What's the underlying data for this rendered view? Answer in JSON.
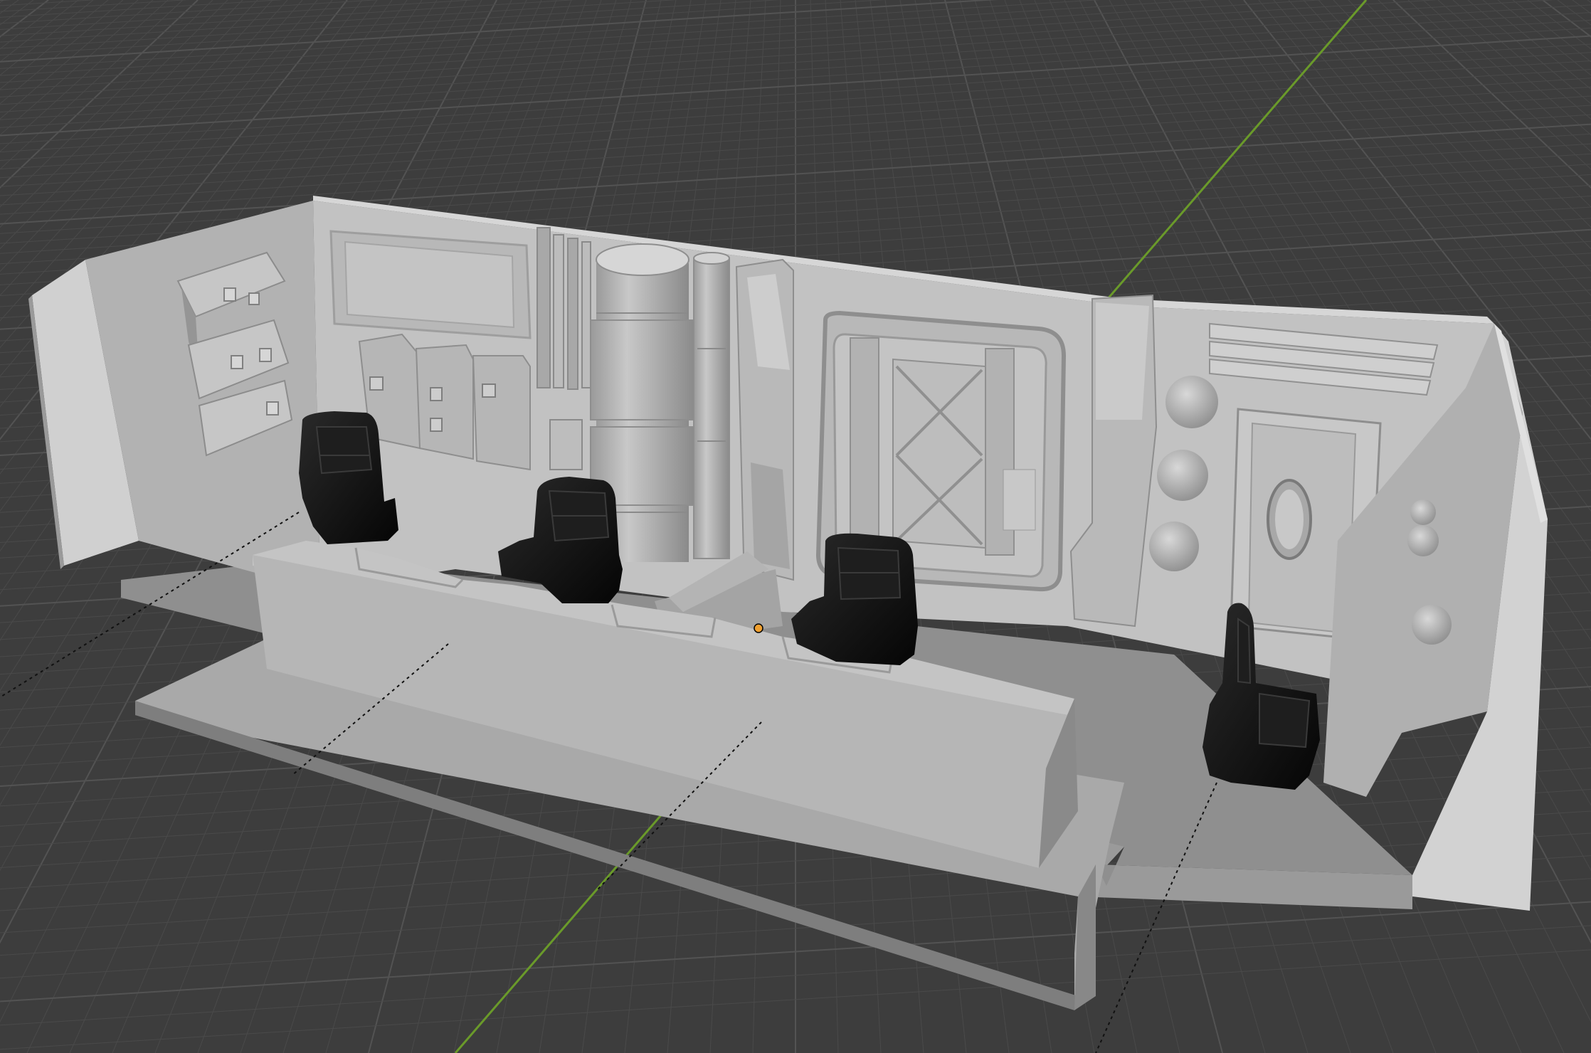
{
  "app": "3D viewport",
  "viewport": {
    "background_color": "#3d3d3d",
    "grid_line_color": "#4a4a4a",
    "grid_line_strong_color": "#535353",
    "y_axis_color": "#6a9a2a",
    "origin_marker_color": "#f0a030"
  },
  "scene": {
    "model_name": "cockpit-room",
    "seat_color": "#0d0d0d",
    "seat_count": 4,
    "wall_color_light": "#bdbdbd",
    "wall_color_mid": "#a8a8a8",
    "wall_color_dark": "#8c8c8c",
    "floor_color": "#9a9a9a"
  }
}
